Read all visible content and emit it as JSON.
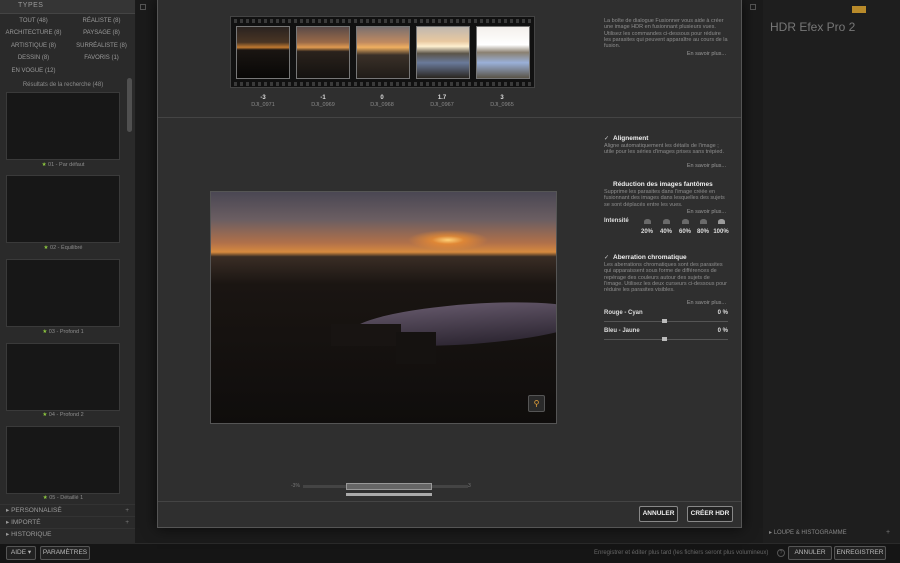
{
  "left_panel": {
    "types_header": "TYPES",
    "type_filters": [
      "TOUT (48)",
      "RÉALISTE (8)",
      "ARCHITECTURE (8)",
      "PAYSAGE (8)",
      "ARTISTIQUE (8)",
      "SURRÉALISTE (8)",
      "DESSIN (8)",
      "FAVORIS (1)",
      "EN VOGUE (12)"
    ],
    "results_title": "Résultats de la recherche (48)",
    "presets": [
      {
        "num": "01",
        "name": "Par défaut"
      },
      {
        "num": "02",
        "name": "Équilibré"
      },
      {
        "num": "03",
        "name": "Profond 1"
      },
      {
        "num": "04",
        "name": "Profond 2"
      },
      {
        "num": "05",
        "name": "Détaillé 1"
      }
    ],
    "sections": [
      "PERSONNALISÉ",
      "IMPORTÉ",
      "HISTORIQUE"
    ]
  },
  "right_panel": {
    "title": "HDR Efex Pro 2",
    "loupe": "LOUPE & HISTOGRAMME"
  },
  "bottom_bar": {
    "help_btn": "AIDE",
    "params_btn": "PARAMÈTRES",
    "save_hint": "Enregistrer et éditer plus tard (les fichiers seront plus volumineux)",
    "cancel_btn": "ANNULER",
    "save_btn": "ENREGISTRER"
  },
  "dialog": {
    "exposures": [
      {
        "ev": "-3",
        "file": "DJI_0971"
      },
      {
        "ev": "-1",
        "file": "DJI_0969"
      },
      {
        "ev": "0",
        "file": "DJI_0968"
      },
      {
        "ev": "1.7",
        "file": "DJI_0967"
      },
      {
        "ev": "3",
        "file": "DJI_0965"
      }
    ],
    "top_help": "La boîte de dialogue Fusionner vous aide à créer une image HDR en fusionnant plusieurs vues. Utilisez les commandes ci-dessous pour réduire les parasites qui peuvent apparaître au cours de la fusion.",
    "learn_more": "En savoir plus...",
    "alignment": {
      "title": "Alignement",
      "desc": "Aligne automatiquement les détails de l'image ; utile pour les séries d'images prises sans trépied."
    },
    "ghost": {
      "title": "Réduction des images fantômes",
      "desc": "Supprime les parasites dans l'image créée en fusionnant des images dans lesquelles des sujets se sont déplacés entre les vues.",
      "intensity_label": "Intensité",
      "levels": [
        "20%",
        "40%",
        "60%",
        "80%",
        "100%"
      ]
    },
    "chroma": {
      "title": "Aberration chromatique",
      "desc": "Les aberrations chromatiques sont des parasites qui apparaissent sous forme de différences de repérage des couleurs autour des sujets de l'image. Utilisez les deux curseurs ci-dessous pour réduire les parasites visibles.",
      "red_cyan_label": "Rouge - Cyan",
      "red_cyan_value": "0 %",
      "blue_yellow_label": "Bleu - Jaune",
      "blue_yellow_value": "0 %"
    },
    "tone_range": {
      "low": "-3%",
      "high": "3"
    },
    "cancel_btn": "ANNULER",
    "create_btn": "CRÉER HDR"
  }
}
